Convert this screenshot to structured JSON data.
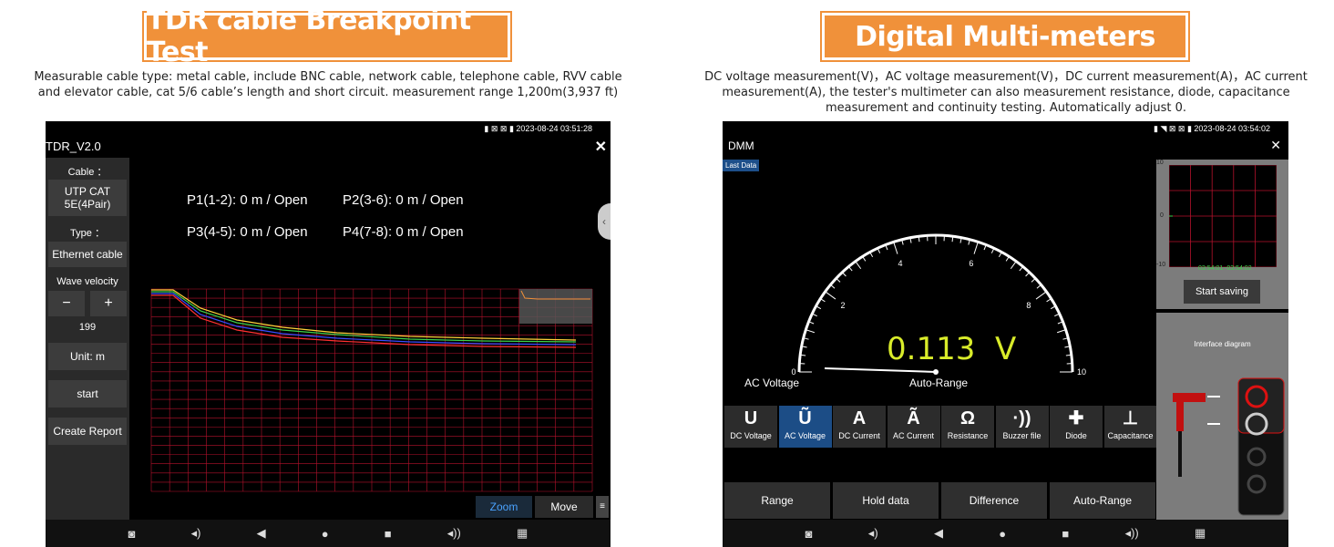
{
  "left": {
    "banner_title": "TDR cable Breakpoint Test",
    "description": "Measurable cable type: metal cable, include BNC cable, network cable, telephone cable, RVV cable and elevator cable, cat 5/6 cable’s length and short circuit. measurement range 1,200m(3,937 ft)",
    "status_time": "2023-08-24 03:51:28",
    "app_title": "TDR_V2.0",
    "cable_label": "Cable ：",
    "cable_value": "UTP CAT 5E(4Pair)",
    "type_label": "Type ：",
    "type_value": "Ethernet cable",
    "wave_velocity_label": "Wave velocity",
    "minus": "−",
    "plus": "+",
    "wave_velocity_value": "199",
    "unit_label": "Unit: m",
    "start_label": "start",
    "report_label": "Create Report",
    "pairs": [
      "P1(1-2): 0 m /  Open",
      "P2(3-6): 0 m /  Open",
      "P3(4-5): 0 m /  Open",
      "P4(7-8): 0 m /  Open"
    ],
    "zoom_label": "Zoom",
    "move_label": "Move",
    "colors": {
      "p1": "#ffd23a",
      "p2": "#3bd04a",
      "p3": "#3a4cff",
      "p4": "#ff3030",
      "grid": "#b5122c"
    }
  },
  "right": {
    "banner_title": "Digital Multi-meters",
    "description": "DC voltage measurement(V)，AC voltage measurement(V)，DC current measurement(A)，AC current measurement(A), the tester's multimeter can also measurement resistance, diode, capacitance measurement and continuity testing. Automatically adjust 0.",
    "status_time": "2023-08-24 03:54:02",
    "app_title": "DMM",
    "last_data": "Last Data",
    "reading": "0.113  V",
    "mode_label": "AC Voltage",
    "range_mode": "Auto-Range",
    "gauge_ticks": [
      "0",
      "2",
      "4",
      "6",
      "8",
      "10"
    ],
    "mini_chart": {
      "y_top": "10",
      "y_mid": "0",
      "y_bot": "-10",
      "time_range": "03:54:01~03:54:02"
    },
    "start_saving": "Start saving",
    "interface_diagram": "Interface diagram",
    "functions": [
      {
        "icon": "U",
        "label": "DC Voltage"
      },
      {
        "icon": "Ũ",
        "label": "AC Voltage"
      },
      {
        "icon": "A",
        "label": "DC Current"
      },
      {
        "icon": "Ã",
        "label": "AC Current"
      },
      {
        "icon": "Ω",
        "label": "Resistance"
      },
      {
        "icon": "·))",
        "label": "Buzzer file"
      },
      {
        "icon": "✚",
        "label": "Diode"
      },
      {
        "icon": "⊥",
        "label": "Capacitance"
      }
    ],
    "bottom_buttons": [
      "Range",
      "Hold data",
      "Difference",
      "Auto-Range"
    ]
  },
  "navbar_icons": [
    "camera-icon",
    "volume-down-icon",
    "back-icon",
    "home-icon",
    "recents-icon",
    "volume-up-icon",
    "apps-icon"
  ]
}
